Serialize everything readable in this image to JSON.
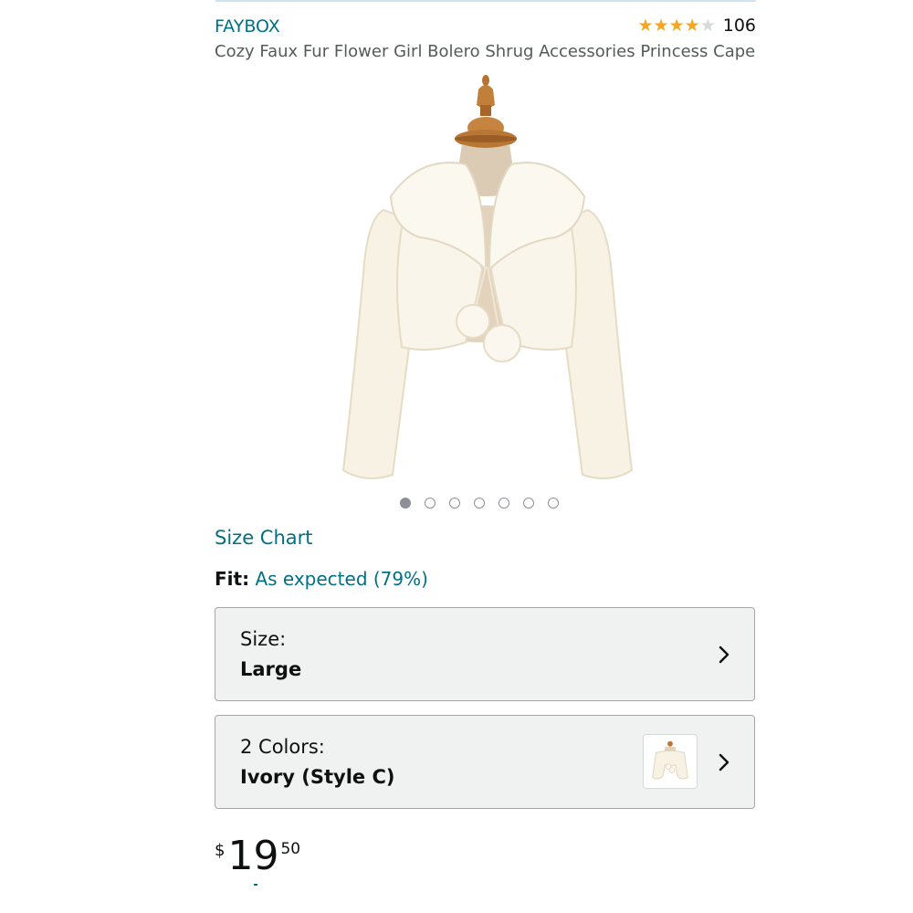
{
  "product": {
    "brand": "FAYBOX",
    "rating": 4,
    "rating_max": 5,
    "review_count": "106",
    "title": "Cozy Faux Fur Flower Girl Bolero Shrug Accessories Princess Cape",
    "image_icon": "jacket-image",
    "image_count": 7,
    "active_image": 1
  },
  "links": {
    "size_chart": "Size Chart"
  },
  "fit": {
    "label": "Fit:",
    "value": "As expected (79%)"
  },
  "size_selector": {
    "label": "Size:",
    "value": "Large",
    "icon": "chevron-right-icon"
  },
  "color_selector": {
    "label": "2 Colors:",
    "value": "Ivory (Style C)",
    "icon": "chevron-right-icon",
    "swatch_icon": "jacket-swatch-icon"
  },
  "price": {
    "symbol": "$",
    "whole": "19",
    "fraction": "50"
  },
  "colors": {
    "link": "#007185",
    "star": "#f5a623",
    "fur": "#f7f2e4"
  }
}
